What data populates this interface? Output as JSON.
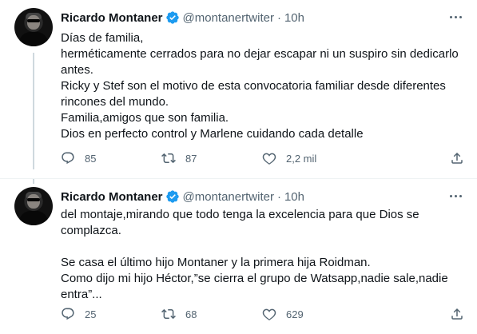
{
  "tweets": [
    {
      "author": "Ricardo Montaner",
      "handle": "@montanertwiter",
      "separator": "·",
      "time": "10h",
      "lines": [
        "Días de familia,",
        "herméticamente cerrados para no dejar escapar ni un suspiro sin dedicarlo",
        "antes.",
        "Ricky y Stef son el motivo de esta convocatoria familiar desde diferentes",
        "rincones del mundo.",
        "Familia,amigos que son familia.",
        "Dios en perfecto control y Marlene cuidando cada detalle"
      ],
      "replies": "85",
      "retweets": "87",
      "likes": "2,2 mil"
    },
    {
      "author": "Ricardo Montaner",
      "handle": "@montanertwiter",
      "separator": "·",
      "time": "10h",
      "lines": [
        "del montaje,mirando que todo tenga la excelencia para que Dios se",
        "complazca.",
        "",
        "Se casa el último hijo Montaner y la primera hija Roidman.",
        "Como dijo mi hijo Héctor,”se cierra el grupo de Watsapp,nadie sale,nadie",
        "entra”..."
      ],
      "replies": "25",
      "retweets": "68",
      "likes": "629"
    }
  ],
  "icons": {
    "verified": "verified-badge-icon",
    "more": "more-options-icon",
    "reply": "reply-icon",
    "retweet": "retweet-icon",
    "like": "heart-icon",
    "share": "share-icon"
  },
  "colors": {
    "text": "#0f1419",
    "secondary": "#536471",
    "verified": "#1d9bf0",
    "thread_line": "#cfd9de",
    "divider": "#eff3f4"
  }
}
